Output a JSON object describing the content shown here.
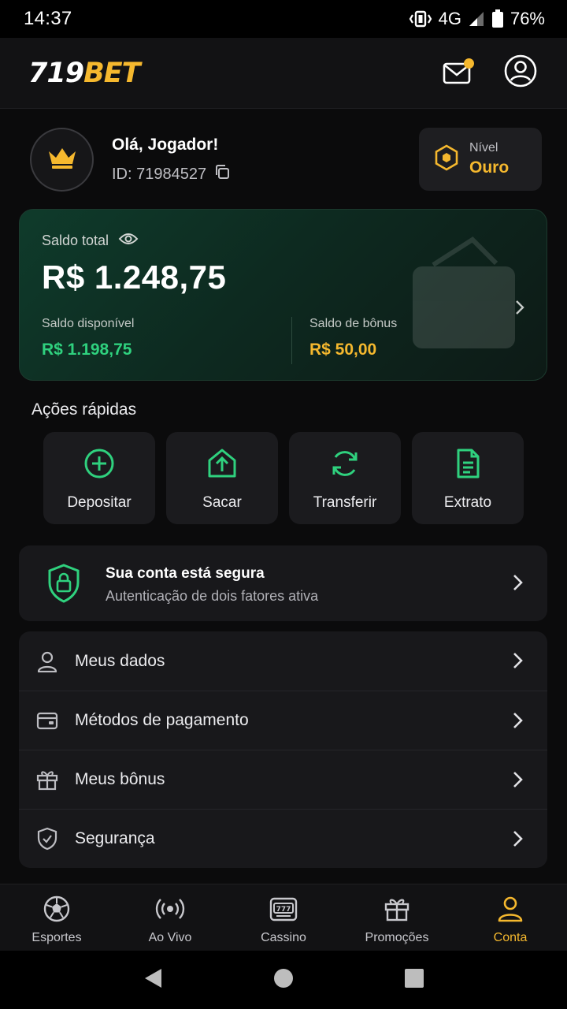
{
  "status_bar": {
    "time": "14:37",
    "network": "4G",
    "battery": "76%"
  },
  "header": {
    "logo_number": "719",
    "logo_brand": "BET",
    "accent_color": "#f5b82e",
    "icons": [
      "mail-icon",
      "user-circle-icon"
    ]
  },
  "profile": {
    "greeting": "Olá, Jogador!",
    "id_text": "ID: 71984527",
    "level_label": "Nível",
    "level_value": "Ouro"
  },
  "balance": {
    "label": "Saldo total",
    "total": "R$ 1.248,75",
    "available_label": "Saldo disponível",
    "available_value": "R$ 1.198,75",
    "bonus_label": "Saldo de bônus",
    "bonus_value": "R$ 50,00",
    "green_color": "#2fd17e"
  },
  "quick_actions": {
    "title": "Ações rápidas",
    "items": [
      {
        "label": "Depositar",
        "icon": "plus-circle-icon"
      },
      {
        "label": "Sacar",
        "icon": "upload-icon"
      },
      {
        "label": "Transferir",
        "icon": "refresh-icon"
      },
      {
        "label": "Extrato",
        "icon": "document-icon"
      }
    ]
  },
  "security_banner": {
    "title": "Sua conta está segura",
    "subtitle": "Autenticação de dois fatores ativa"
  },
  "menu": {
    "items": [
      {
        "label": "Meus dados",
        "icon": "user-icon"
      },
      {
        "label": "Métodos de pagamento",
        "icon": "wallet-icon"
      },
      {
        "label": "Meus bônus",
        "icon": "gift-icon"
      },
      {
        "label": "Segurança",
        "icon": "shield-check-icon"
      }
    ]
  },
  "bottom_nav": {
    "items": [
      {
        "label": "Esportes",
        "icon": "soccer-ball-icon"
      },
      {
        "label": "Ao Vivo",
        "icon": "live-broadcast-icon"
      },
      {
        "label": "Cassino",
        "icon": "slot-machine-icon"
      },
      {
        "label": "Promoções",
        "icon": "gift-icon"
      },
      {
        "label": "Conta",
        "icon": "user-icon",
        "active": true
      }
    ]
  }
}
